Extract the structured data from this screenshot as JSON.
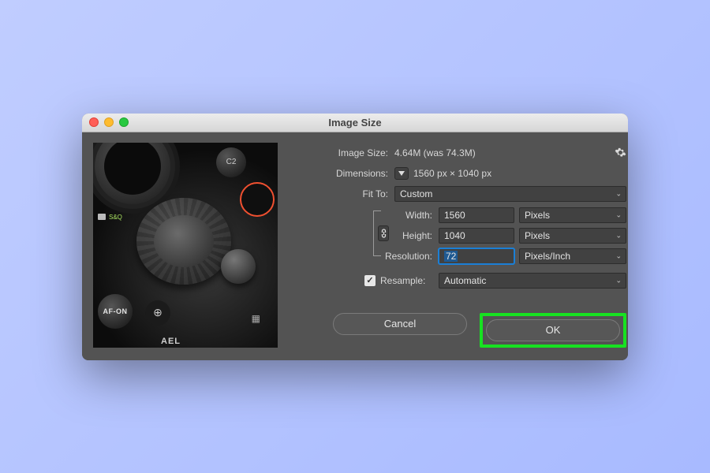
{
  "window_title": "Image Size",
  "image_size": {
    "label": "Image Size:",
    "value": "4.64M (was 74.3M)"
  },
  "dimensions": {
    "label": "Dimensions:",
    "value": "1560 px × 1040 px"
  },
  "fit_to": {
    "label": "Fit To:",
    "value": "Custom"
  },
  "width": {
    "label": "Width:",
    "value": "1560",
    "unit": "Pixels"
  },
  "height": {
    "label": "Height:",
    "value": "1040",
    "unit": "Pixels"
  },
  "resolution": {
    "label": "Resolution:",
    "value": "72",
    "unit": "Pixels/Inch"
  },
  "resample": {
    "label": "Resample:",
    "checked": true,
    "value": "Automatic"
  },
  "buttons": {
    "cancel": "Cancel",
    "ok": "OK"
  },
  "preview_labels": {
    "c2": "C2",
    "afon": "AF-ON",
    "ael": "AEL",
    "mode": "S&Q"
  }
}
